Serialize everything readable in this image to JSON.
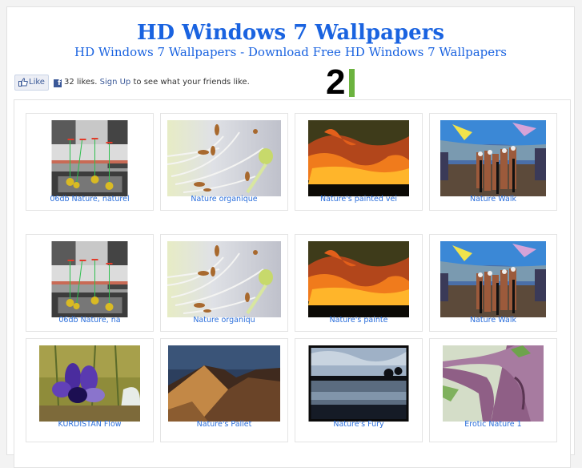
{
  "header": {
    "title": "HD Windows 7 Wallpapers",
    "subtitle": "HD Windows 7 Wallpapers - Download Free HD Windows 7 Wallpapers"
  },
  "facebook": {
    "like_label": "Like",
    "likes_text": "32 likes.",
    "signup_label": "Sign Up",
    "friends_text": "to see what your friends like."
  },
  "logo": {
    "text": "2",
    "accent_color": "#6cb33f"
  },
  "gallery": {
    "rows": [
      [
        {
          "caption": "06db Nature, naturel",
          "image": "nature-diagram-photo"
        },
        {
          "caption": "Nature organique",
          "image": "flower-stamens-photo"
        },
        {
          "caption": "Nature's painted vei",
          "image": "orange-sunset-clouds-photo"
        },
        {
          "caption": "Nature Walk",
          "image": "psychedelic-people-photo"
        }
      ],
      [
        {
          "caption": "06db Nature, na",
          "image": "nature-diagram-photo"
        },
        {
          "caption": "Nature organiqu",
          "image": "flower-stamens-photo"
        },
        {
          "caption": "Nature's painte",
          "image": "orange-sunset-clouds-photo"
        },
        {
          "caption": "Nature Walk",
          "image": "psychedelic-people-photo"
        }
      ],
      [
        {
          "caption": "KURDISTAN Flow",
          "image": "purple-flower-photo"
        },
        {
          "caption": "Nature's Pallet",
          "image": "mountains-photo"
        },
        {
          "caption": "Nature's Fury",
          "image": "stormy-lake-photo"
        },
        {
          "caption": "Erotic Nature 1",
          "image": "purple-tree-trunk-photo"
        }
      ]
    ]
  },
  "colors": {
    "link": "#2a6edb",
    "title": "#1a63e0",
    "fb_blue": "#3b5998"
  }
}
